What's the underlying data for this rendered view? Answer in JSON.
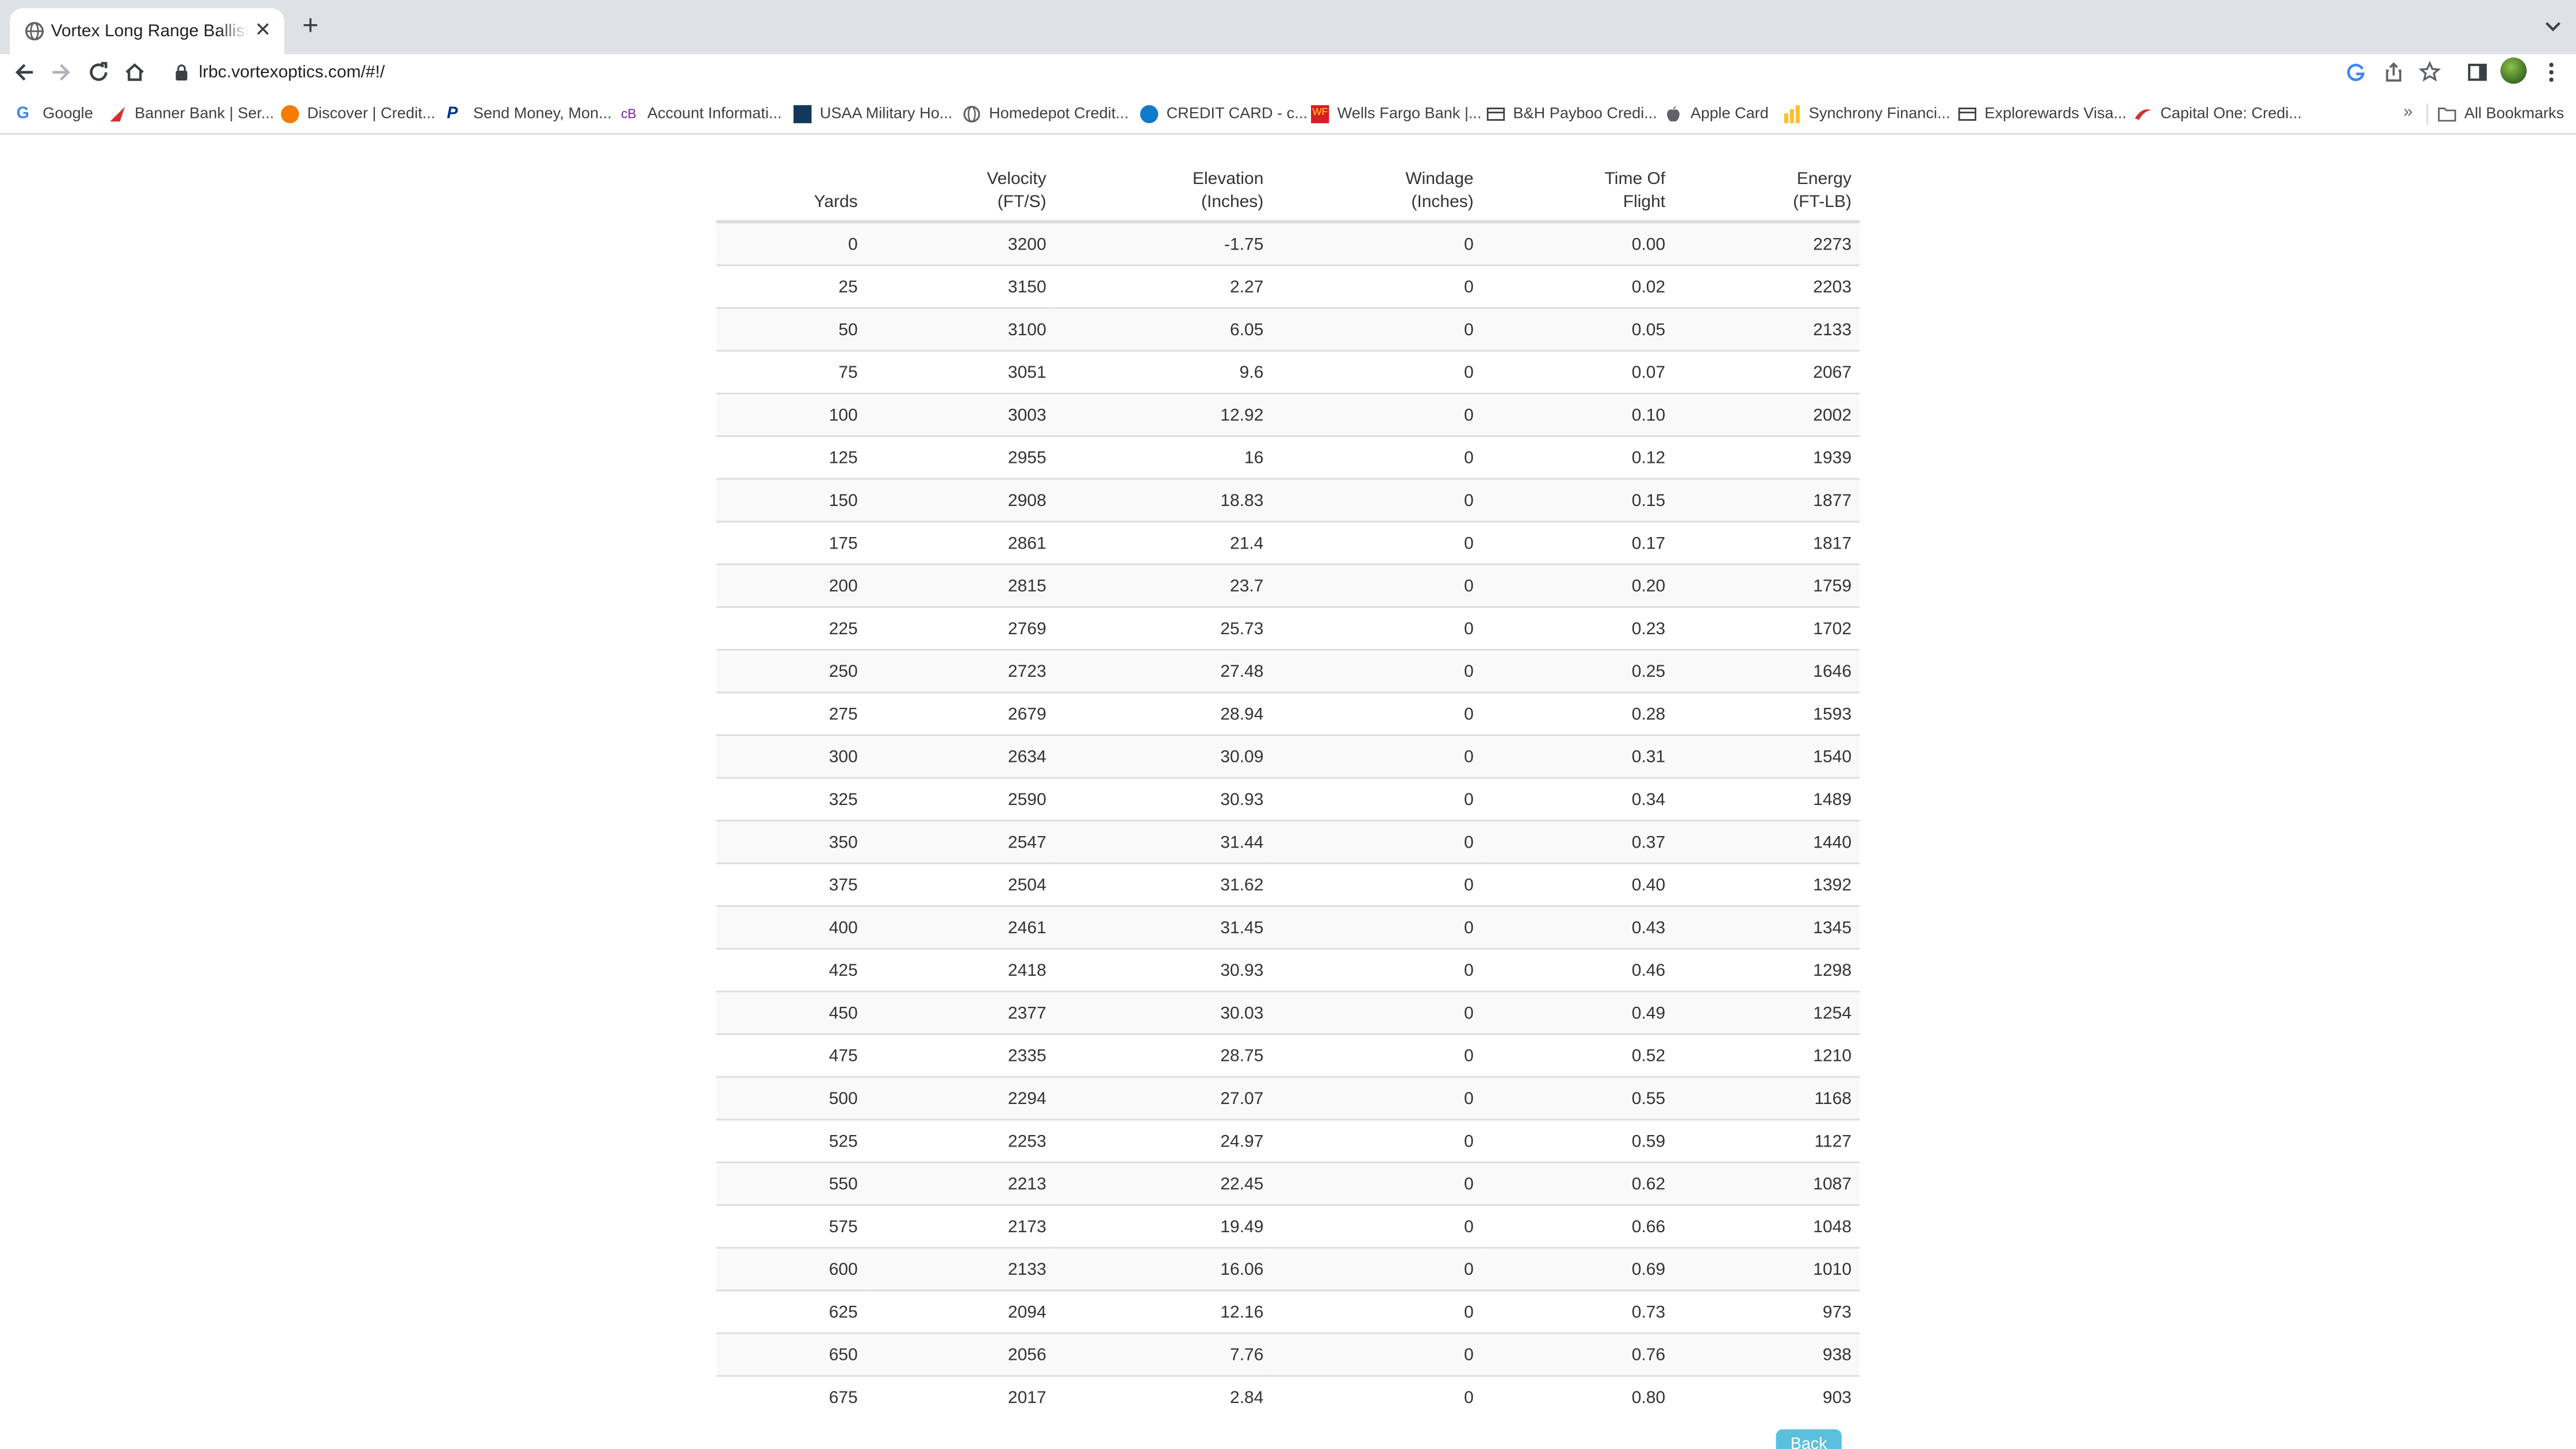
{
  "browser": {
    "tab_title": "Vortex Long Range Ballistics C",
    "url": "lrbc.vortexoptics.com/#!/",
    "bookmarks": [
      {
        "label": "Google",
        "icon": "google-icon",
        "color": "#4285f4"
      },
      {
        "label": "Banner Bank | Ser...",
        "icon": "banner-bank-icon",
        "color": "#d32f2f"
      },
      {
        "label": "Discover | Credit...",
        "icon": "discover-icon",
        "color": "#f57c00"
      },
      {
        "label": "Send Money, Mon...",
        "icon": "paypal-icon",
        "color": "#003087"
      },
      {
        "label": "Account Informati...",
        "icon": "account-icon",
        "color": "#7b1fa2"
      },
      {
        "label": "USAA Military Ho...",
        "icon": "usaa-icon",
        "color": "#12395b"
      },
      {
        "label": "Homedepot Credit...",
        "icon": "globe-icon",
        "color": "#5f6368"
      },
      {
        "label": "CREDIT CARD - c...",
        "icon": "chase-icon",
        "color": "#117aca"
      },
      {
        "label": "Wells Fargo Bank |...",
        "icon": "wells-fargo-icon",
        "color": "#d71e28"
      },
      {
        "label": "B&H Payboo Credi...",
        "icon": "card-icon",
        "color": "#3c4043"
      },
      {
        "label": "Apple Card",
        "icon": "apple-icon",
        "color": "#5f6368"
      },
      {
        "label": "Synchrony Financi...",
        "icon": "synchrony-icon",
        "color": "#fbc02d"
      },
      {
        "label": "Explorewards Visa...",
        "icon": "card-icon",
        "color": "#3c4043"
      },
      {
        "label": "Capital One: Credi...",
        "icon": "capital-one-icon",
        "color": "#d03027"
      }
    ],
    "more_bookmarks": "»",
    "all_bookmarks": "All Bookmarks"
  },
  "table": {
    "headers": [
      [
        "",
        "Yards"
      ],
      [
        "Velocity",
        "(FT/S)"
      ],
      [
        "Elevation",
        "(Inches)"
      ],
      [
        "Windage",
        "(Inches)"
      ],
      [
        "Time Of",
        "Flight"
      ],
      [
        "Energy",
        "(FT-LB)"
      ]
    ],
    "rows": [
      [
        "0",
        "3200",
        "-1.75",
        "0",
        "0.00",
        "2273"
      ],
      [
        "25",
        "3150",
        "2.27",
        "0",
        "0.02",
        "2203"
      ],
      [
        "50",
        "3100",
        "6.05",
        "0",
        "0.05",
        "2133"
      ],
      [
        "75",
        "3051",
        "9.6",
        "0",
        "0.07",
        "2067"
      ],
      [
        "100",
        "3003",
        "12.92",
        "0",
        "0.10",
        "2002"
      ],
      [
        "125",
        "2955",
        "16",
        "0",
        "0.12",
        "1939"
      ],
      [
        "150",
        "2908",
        "18.83",
        "0",
        "0.15",
        "1877"
      ],
      [
        "175",
        "2861",
        "21.4",
        "0",
        "0.17",
        "1817"
      ],
      [
        "200",
        "2815",
        "23.7",
        "0",
        "0.20",
        "1759"
      ],
      [
        "225",
        "2769",
        "25.73",
        "0",
        "0.23",
        "1702"
      ],
      [
        "250",
        "2723",
        "27.48",
        "0",
        "0.25",
        "1646"
      ],
      [
        "275",
        "2679",
        "28.94",
        "0",
        "0.28",
        "1593"
      ],
      [
        "300",
        "2634",
        "30.09",
        "0",
        "0.31",
        "1540"
      ],
      [
        "325",
        "2590",
        "30.93",
        "0",
        "0.34",
        "1489"
      ],
      [
        "350",
        "2547",
        "31.44",
        "0",
        "0.37",
        "1440"
      ],
      [
        "375",
        "2504",
        "31.62",
        "0",
        "0.40",
        "1392"
      ],
      [
        "400",
        "2461",
        "31.45",
        "0",
        "0.43",
        "1345"
      ],
      [
        "425",
        "2418",
        "30.93",
        "0",
        "0.46",
        "1298"
      ],
      [
        "450",
        "2377",
        "30.03",
        "0",
        "0.49",
        "1254"
      ],
      [
        "475",
        "2335",
        "28.75",
        "0",
        "0.52",
        "1210"
      ],
      [
        "500",
        "2294",
        "27.07",
        "0",
        "0.55",
        "1168"
      ],
      [
        "525",
        "2253",
        "24.97",
        "0",
        "0.59",
        "1127"
      ],
      [
        "550",
        "2213",
        "22.45",
        "0",
        "0.62",
        "1087"
      ],
      [
        "575",
        "2173",
        "19.49",
        "0",
        "0.66",
        "1048"
      ],
      [
        "600",
        "2133",
        "16.06",
        "0",
        "0.69",
        "1010"
      ],
      [
        "625",
        "2094",
        "12.16",
        "0",
        "0.73",
        "973"
      ],
      [
        "650",
        "2056",
        "7.76",
        "0",
        "0.76",
        "938"
      ],
      [
        "675",
        "2017",
        "2.84",
        "0",
        "0.80",
        "903"
      ]
    ]
  },
  "back_button": "Back",
  "colors": {
    "accent": "#5bc0de",
    "stripe": "#f9f9f9",
    "rule": "#dddddd"
  }
}
